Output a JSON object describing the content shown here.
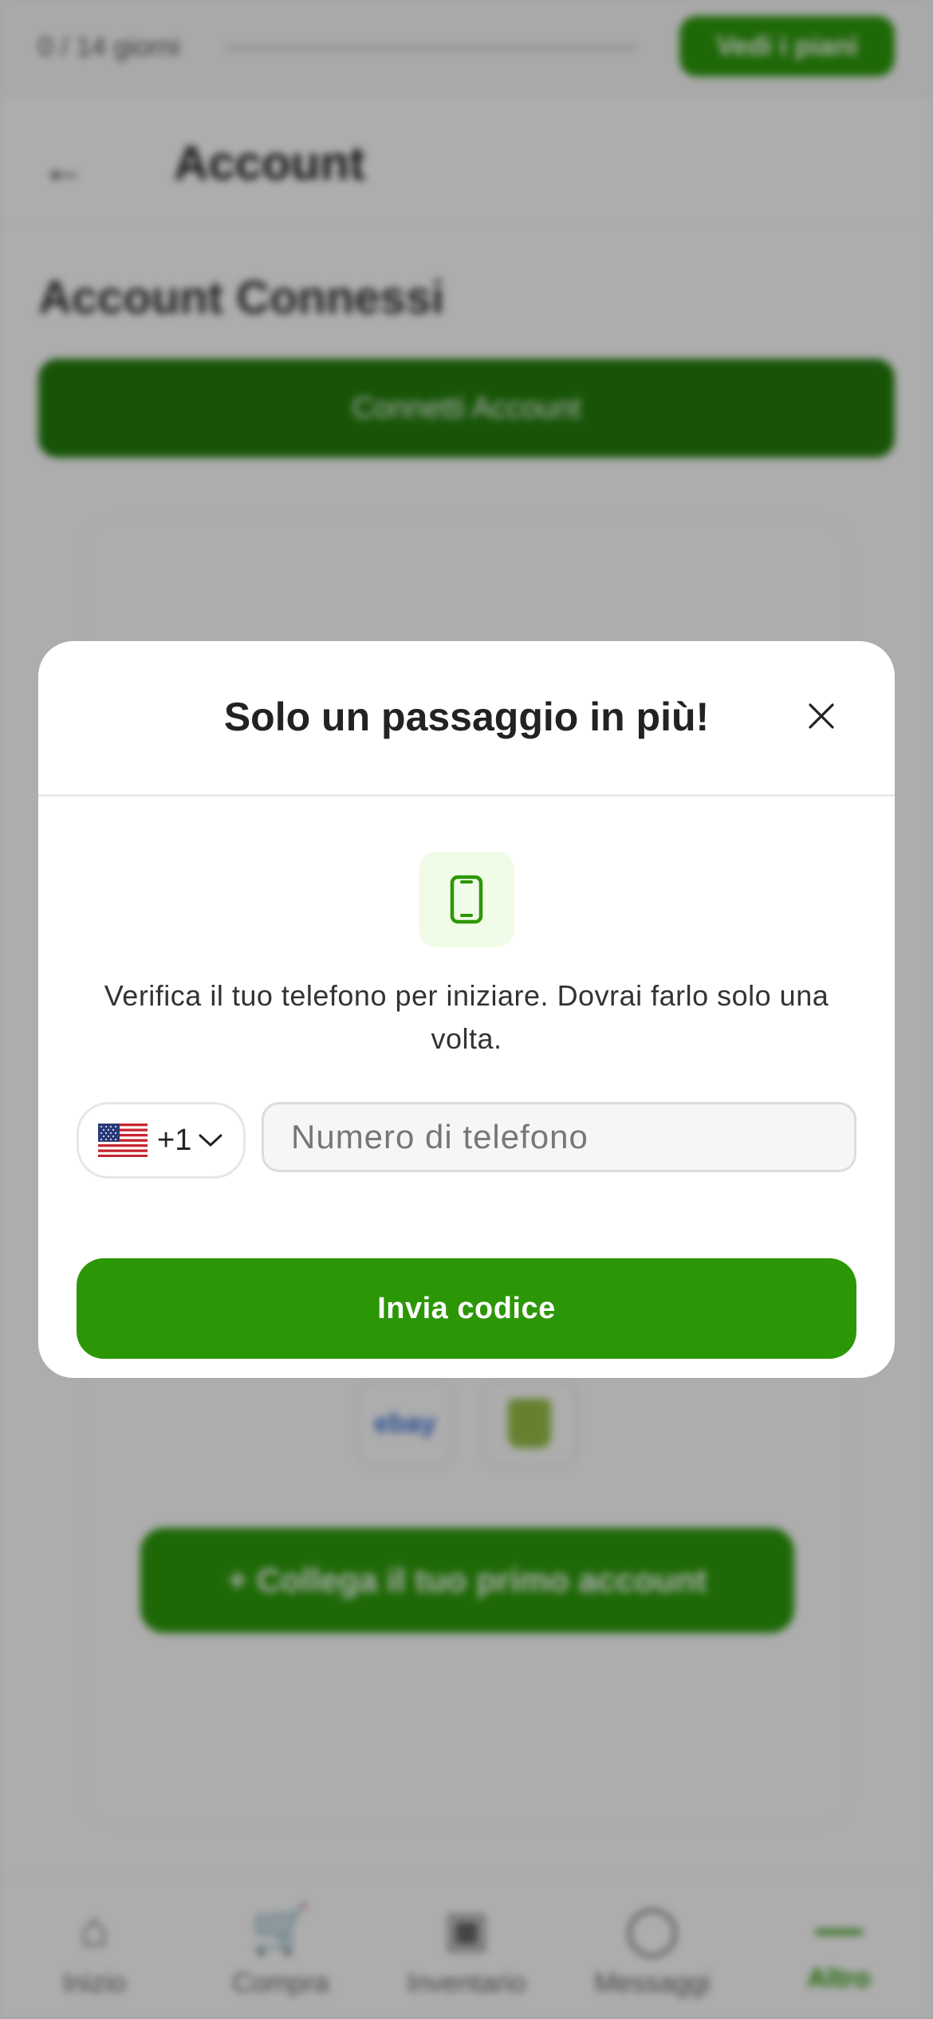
{
  "trial": {
    "text": "0 / 14 giorni",
    "button_label": "Vedi i piani"
  },
  "header": {
    "title": "Account"
  },
  "section": {
    "title": "Account Connessi",
    "connect_button": "Connetti Account"
  },
  "card": {
    "ebay_logo": "ebay",
    "first_account_button": "+  Collega il tuo primo account"
  },
  "tabbar": {
    "items": [
      {
        "label": "Inizio",
        "icon": "home-icon"
      },
      {
        "label": "Compra",
        "icon": "cart-icon"
      },
      {
        "label": "Inventario",
        "icon": "box-icon"
      },
      {
        "label": "Messaggi",
        "icon": "chat-icon"
      },
      {
        "label": "Altro",
        "icon": "more-icon",
        "active": true
      }
    ]
  },
  "modal": {
    "title": "Solo un passaggio in più!",
    "description": "Verifica il tuo telefono per iniziare. Dovrai farlo solo una volta.",
    "country_code": "+1",
    "country_flag": "us-flag-icon",
    "phone_placeholder": "Numero di telefono",
    "phone_value": "",
    "submit_label": "Invia codice"
  },
  "colors": {
    "accent": "#2c9706",
    "accent_dark": "#237d0c",
    "icon_tile": "#f0fbe8"
  }
}
